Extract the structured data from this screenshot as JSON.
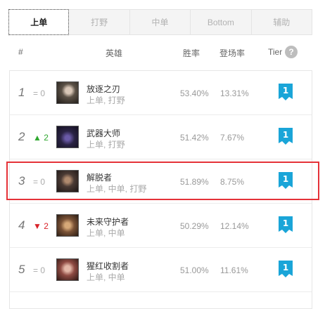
{
  "tabs": [
    {
      "label": "上单",
      "active": true
    },
    {
      "label": "打野",
      "active": false
    },
    {
      "label": "中单",
      "active": false
    },
    {
      "label": "Bottom",
      "active": false
    },
    {
      "label": "辅助",
      "active": false
    }
  ],
  "headers": {
    "rank": "#",
    "champion": "英雄",
    "winrate": "胜率",
    "pickrate": "登场率",
    "tier": "Tier",
    "help": "?"
  },
  "rows": [
    {
      "rank": "1",
      "trend": "= 0",
      "name": "放逐之刃",
      "positions": "上单, 打野",
      "winrate": "53.40%",
      "pickrate": "13.31%",
      "tier": "1"
    },
    {
      "rank": "2",
      "trend": "▲ 2",
      "name": "武器大师",
      "positions": "上单, 打野",
      "winrate": "51.42%",
      "pickrate": "7.67%",
      "tier": "1"
    },
    {
      "rank": "3",
      "trend": "= 0",
      "name": "解脱者",
      "positions": "上单, 中单, 打野",
      "winrate": "51.89%",
      "pickrate": "8.75%",
      "tier": "1"
    },
    {
      "rank": "4",
      "trend": "▼ 2",
      "name": "未来守护者",
      "positions": "上单, 中单",
      "winrate": "50.29%",
      "pickrate": "12.14%",
      "tier": "1"
    },
    {
      "rank": "5",
      "trend": "= 0",
      "name": "猩红收割者",
      "positions": "上单, 中单",
      "winrate": "51.00%",
      "pickrate": "11.61%",
      "tier": "1"
    }
  ],
  "colors": {
    "tier_badge": "#1aa5d8",
    "trend_up": "#2fa82f",
    "trend_down": "#d8232a",
    "highlight": "#e53238"
  }
}
